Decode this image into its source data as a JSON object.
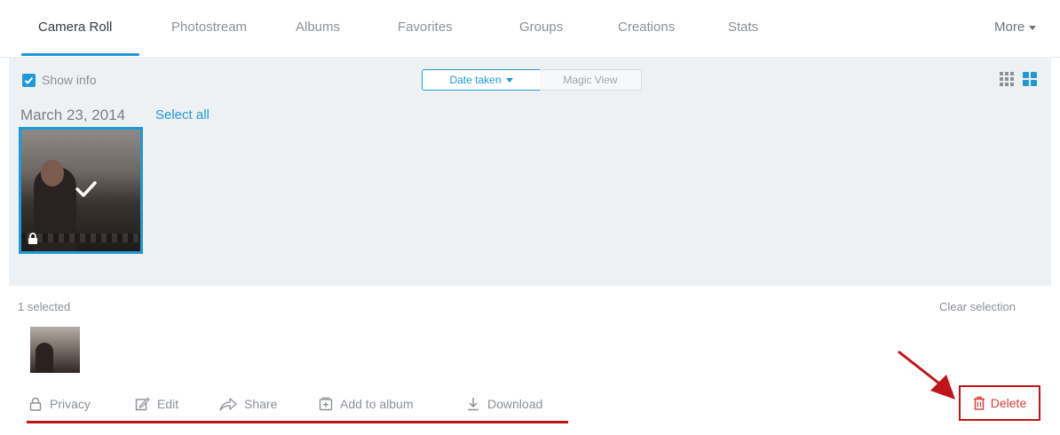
{
  "tabs": [
    {
      "label": "Camera Roll",
      "active": true
    },
    {
      "label": "Photostream",
      "active": false
    },
    {
      "label": "Albums",
      "active": false
    },
    {
      "label": "Favorites",
      "active": false
    },
    {
      "label": "Groups",
      "active": false
    },
    {
      "label": "Creations",
      "active": false
    },
    {
      "label": "Stats",
      "active": false
    }
  ],
  "more_label": "More",
  "toolbar": {
    "show_info_label": "Show info",
    "show_info_checked": true,
    "date_taken_label": "Date taken",
    "magic_view_label": "Magic View",
    "grid_small_icon": "grid-small-icon",
    "grid_large_icon": "grid-large-icon"
  },
  "roll": {
    "date_label": "March 23, 2014",
    "select_all_label": "Select all"
  },
  "selection": {
    "count_label": "1 selected",
    "clear_label": "Clear selection"
  },
  "actions": {
    "privacy": "Privacy",
    "edit": "Edit",
    "share": "Share",
    "add_to_album": "Add to album",
    "download": "Download",
    "delete": "Delete"
  },
  "colors": {
    "accent": "#1f9ad6",
    "annotation_red": "#c0141b",
    "panel_bg": "#eef1f4"
  }
}
